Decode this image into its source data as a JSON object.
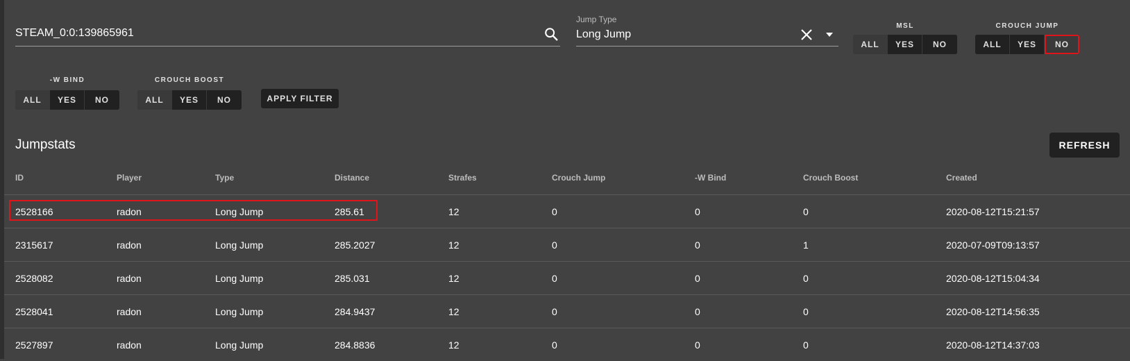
{
  "filters": {
    "search": {
      "value": "STEAM_0:0:139865961",
      "placeholder": ""
    },
    "jump_type": {
      "label": "Jump Type",
      "value": "Long Jump"
    },
    "msl": {
      "title": "MSL",
      "options": [
        "ALL",
        "YES",
        "NO"
      ],
      "selected": "ALL"
    },
    "crouch_jump": {
      "title": "CROUCH JUMP",
      "options": [
        "ALL",
        "YES",
        "NO"
      ],
      "selected": "NO"
    },
    "w_bind": {
      "title": "-W BIND",
      "options": [
        "ALL",
        "YES",
        "NO"
      ],
      "selected": "ALL"
    },
    "crouch_boost": {
      "title": "CROUCH BOOST",
      "options": [
        "ALL",
        "YES",
        "NO"
      ],
      "selected": "ALL"
    },
    "apply_label": "APPLY FILTER"
  },
  "jumpstats": {
    "title": "Jumpstats",
    "refresh_label": "REFRESH",
    "columns": [
      "ID",
      "Player",
      "Type",
      "Distance",
      "Strafes",
      "Crouch Jump",
      "-W Bind",
      "Crouch Boost",
      "Created"
    ],
    "rows": [
      [
        "2528166",
        "radon",
        "Long Jump",
        "285.61",
        "12",
        "0",
        "0",
        "0",
        "2020-08-12T15:21:57"
      ],
      [
        "2315617",
        "radon",
        "Long Jump",
        "285.2027",
        "12",
        "0",
        "0",
        "1",
        "2020-07-09T09:13:57"
      ],
      [
        "2528082",
        "radon",
        "Long Jump",
        "285.031",
        "12",
        "0",
        "0",
        "0",
        "2020-08-12T15:04:34"
      ],
      [
        "2528041",
        "radon",
        "Long Jump",
        "284.9437",
        "12",
        "0",
        "0",
        "0",
        "2020-08-12T14:56:35"
      ],
      [
        "2527897",
        "radon",
        "Long Jump",
        "284.8836",
        "12",
        "0",
        "0",
        "0",
        "2020-08-12T14:37:03"
      ]
    ]
  },
  "colors": {
    "background": "#424242",
    "button_dark": "#212121",
    "highlight_red": "#e0141b"
  },
  "icons": {
    "search": "search-icon",
    "clear": "close-icon",
    "dropdown": "arrow-drop-down-icon"
  }
}
